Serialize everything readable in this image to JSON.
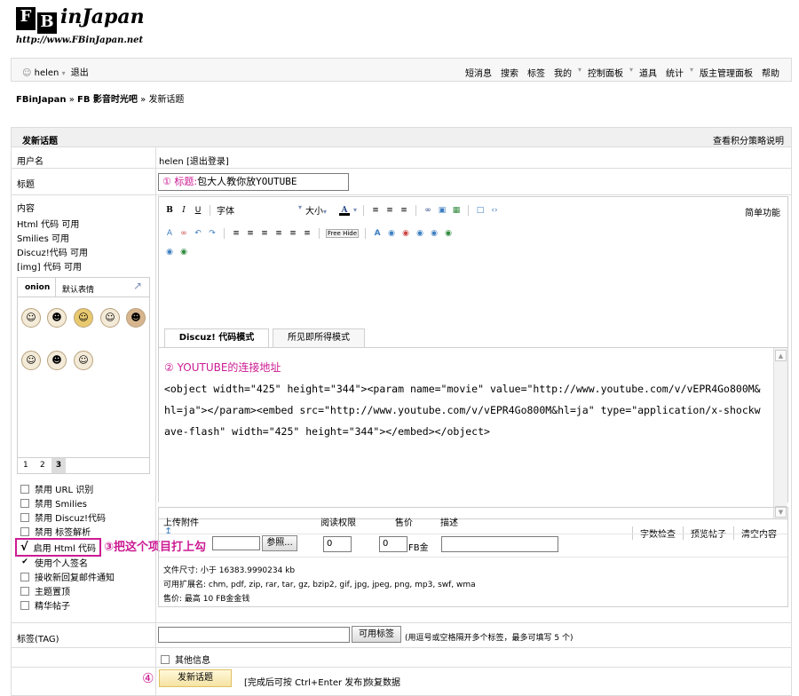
{
  "logo": {
    "box1": "F",
    "box2": "B",
    "text": "inJapan",
    "url": "http://www.FBinJapan.net"
  },
  "topbar": {
    "user": "helen",
    "logout": "退出",
    "nav": [
      "短消息",
      "搜索",
      "标签",
      "我的",
      "控制面板",
      "道具",
      "统计",
      "版主管理面板",
      "帮助"
    ]
  },
  "breadcrumb": {
    "site": "FBinJapan",
    "sep1": "»",
    "forum": "FB 影音时光吧",
    "sep2": "»",
    "page": "发新话题"
  },
  "form": {
    "title": "发新话题",
    "credit_link": "查看积分策略说明",
    "username_label": "用户名",
    "username_value": "helen [退出登录]",
    "subject_label": "标题",
    "subject_num": "①",
    "subject_prefix": "标题:",
    "subject_value": "包大人教你放YOUTUBE",
    "content_label": "内容",
    "content_info": [
      "Html 代码 可用",
      "Smilies 可用",
      "Discuz!代码 可用",
      "[img] 代码 可用"
    ]
  },
  "editor": {
    "font_label": "字体",
    "size_label": "大小",
    "simple_mode": "简单功能",
    "tabs": [
      "Discuz! 代码模式",
      "所见即所得模式"
    ],
    "content_num": "②",
    "content_header": "YOUTUBE的连接地址",
    "content_body": "<object width=\"425\" height=\"344\"><param name=\"movie\" value=\"http://www.youtube.com/v/vEPR4Go800M&hl=ja\"></param><embed src=\"http://www.youtube.com/v/vEPR4Go800M&hl=ja\" type=\"application/x-shockwave-flash\" width=\"425\" height=\"344\"></embed></object>",
    "footer_buttons": [
      "字数检查",
      "预览帖子",
      "清空内容"
    ],
    "freehide": "Free Hide"
  },
  "smilies": {
    "tabs": [
      "onion",
      "默认表情"
    ],
    "pages": [
      "1",
      "2",
      "3"
    ],
    "current_page": "3"
  },
  "options": [
    {
      "label": "禁用  URL 识别",
      "checked": false
    },
    {
      "label": "禁用  Smilies",
      "checked": false
    },
    {
      "label": "禁用  Discuz!代码",
      "checked": false
    },
    {
      "label": "禁用  标签解析",
      "checked": false
    },
    {
      "label": "启用  Html 代码",
      "checked": true
    },
    {
      "label": "使用个人签名",
      "checked": true
    },
    {
      "label": "接收新回复邮件通知",
      "checked": false
    },
    {
      "label": "主题置顶",
      "checked": false
    },
    {
      "label": "精华帖子",
      "checked": false
    }
  ],
  "annotation3": "③把这个项目打上勾",
  "attach": {
    "headers": [
      "上传附件",
      "阅读权限",
      "售价",
      "描述"
    ],
    "browse": "参照...",
    "read_perm": "0",
    "price": "0",
    "currency": "FB金",
    "info": [
      "文件尺寸: 小于 16383.9990234 kb",
      "可用扩展名: chm, pdf, zip, rar, tar, gz, bzip2, gif, jpg, jpeg, png, mp3, swf, wma",
      "售价: 最高 10 FB金金钱"
    ]
  },
  "tags": {
    "label": "标签(TAG)",
    "button": "可用标签",
    "hint": "(用逗号或空格隔开多个标签，最多可填写 5 个)"
  },
  "other_info": "其他信息",
  "submit": {
    "num": "④",
    "button": "发新话题",
    "hint": "[完成后可按 Ctrl+Enter 发布]",
    "restore": "恢复数据"
  },
  "colors": {
    "annotation": "#cc1b93",
    "border": "#dcdcdc",
    "header_bg": "#f0f0f0"
  }
}
